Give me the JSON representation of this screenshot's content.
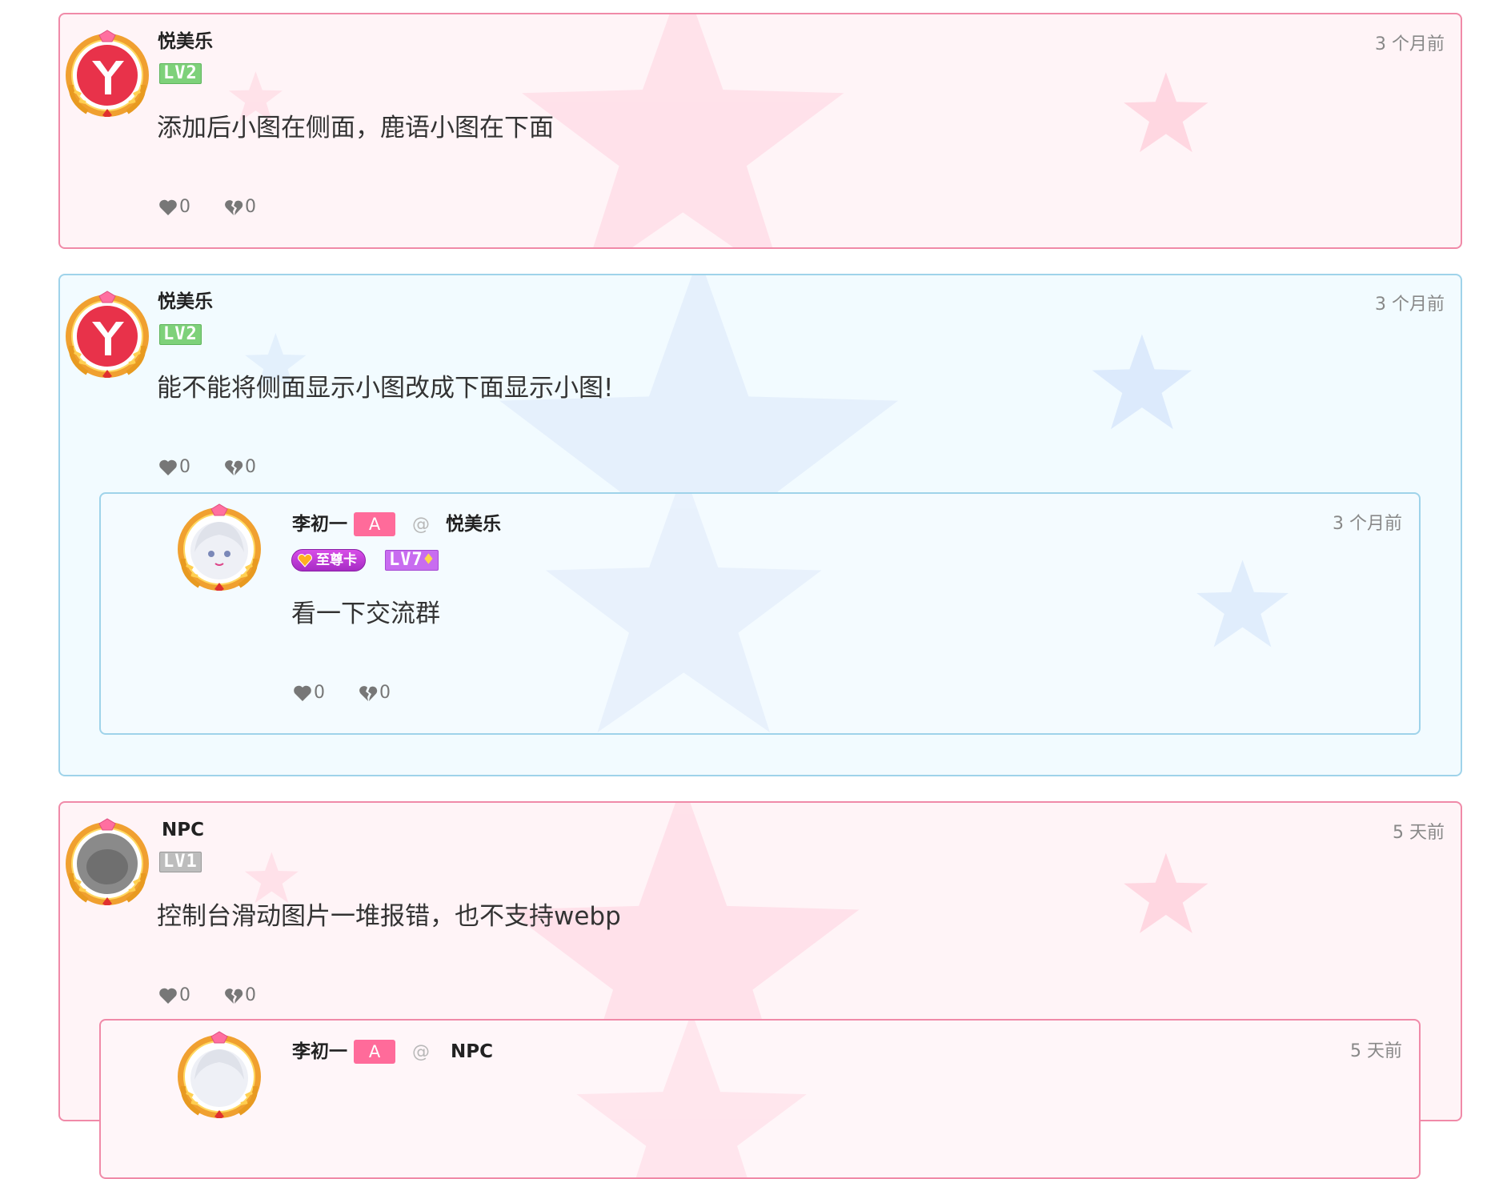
{
  "colors": {
    "pink_border": "#f08aa8",
    "blue_border": "#9fd3ea",
    "tag_pink": "#ff6b9a",
    "level_green": "#7ed17a",
    "level_purple": "#c86cf0"
  },
  "comments": [
    {
      "user": "悦美乐",
      "level": "LV2",
      "time": "3 个月前",
      "text": "添加后小图在侧面，鹿语小图在下面",
      "likes": "0",
      "dislikes": "0",
      "avatar_icon": "red-y-logo-avatar-icon"
    },
    {
      "user": "悦美乐",
      "level": "LV2",
      "time": "3 个月前",
      "text": "能不能将侧面显示小图改成下面显示小图!",
      "likes": "0",
      "dislikes": "0",
      "avatar_icon": "red-y-logo-avatar-icon",
      "reply": {
        "user": "李初一",
        "badge": "A",
        "at": "@",
        "target": "悦美乐",
        "vip": "至尊卡",
        "level": "LV7",
        "time": "3 个月前",
        "text": "看一下交流群",
        "likes": "0",
        "dislikes": "0",
        "avatar_icon": "anime-girl-avatar-icon"
      }
    },
    {
      "user": "NPC",
      "level": "LV1",
      "time": "5 天前",
      "text": "控制台滑动图片一堆报错，也不支持webp",
      "likes": "0",
      "dislikes": "0",
      "avatar_icon": "grey-default-avatar-icon",
      "reply": {
        "user": "李初一",
        "badge": "A",
        "at": "@",
        "target": "NPC",
        "time": "5 天前",
        "avatar_icon": "anime-girl-avatar-icon"
      }
    }
  ]
}
